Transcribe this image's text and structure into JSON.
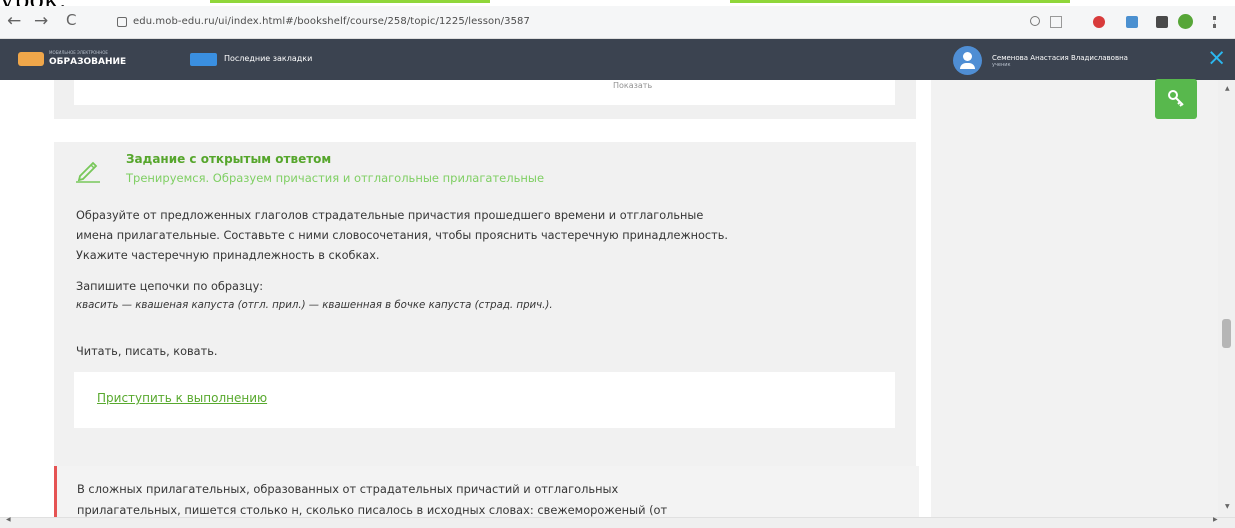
{
  "caption": {
    "text": "урок."
  },
  "browser": {
    "back": "←",
    "forward": "→",
    "reload": "C",
    "url": "edu.mob-edu.ru/ui/index.html#/bookshelf/course/258/topic/1225/lesson/3587",
    "toolbar_icons": [
      "search-icon",
      "star-icon",
      "extension-red-icon",
      "extension-grid-icon",
      "puzzle-icon",
      "profile-icon",
      "menu-icon"
    ],
    "accent_colors": [
      "#f5f6f7",
      "#4d4d4d",
      "#d83b3b",
      "#2f75c0",
      "#57a638"
    ]
  },
  "header": {
    "logo_top": "МОБИЛЬНОЕ ЭЛЕКТРОННОЕ",
    "logo_main": "ОБРАЗОВАНИЕ",
    "bookmarks_label": "Последние закладки",
    "user_name": "Семенова Анастасия Владиславовна",
    "user_role": "ученик",
    "close_icon": "×",
    "colors": {
      "background": "#3b4350",
      "accent": "#2bb8f0",
      "logo": "#f0a74a"
    }
  },
  "previous_block": {
    "show_label": "Показать"
  },
  "task": {
    "icon": "pencil-icon",
    "title": "Задание с открытым ответом",
    "subtitle": "Тренируемся. Образуем причастия и отглагольные прилагательные",
    "description_lines": [
      "Образуйте от предложенных глаголов страдательные причастия прошедшего времени и отглагольные",
      "имена прилагательные. Составьте с ними словосочетания, чтобы прояснить частеречную принадлежность.",
      "Укажите частеречную принадлежность в скобках."
    ],
    "sample_label": "Запишите цепочки по образцу:",
    "sample": "квасить — квашеная капуста (отгл. прил.) — квашенная в бочке капуста (страд. прич.).",
    "words": "Читать, писать, ковать.",
    "action_link": "Приступить к выполнению"
  },
  "rule": {
    "line1": "В сложных прилагательных, образованных от страдательных причастий и отглагольных",
    "line2": "прилагательных, пишется столько н, сколько писалось в исходных словах: свежемороженый (от"
  },
  "sidebar": {
    "key_icon": "key-icon",
    "key_color": "#58b84d"
  },
  "scrollbar": {
    "position": 0.54
  }
}
